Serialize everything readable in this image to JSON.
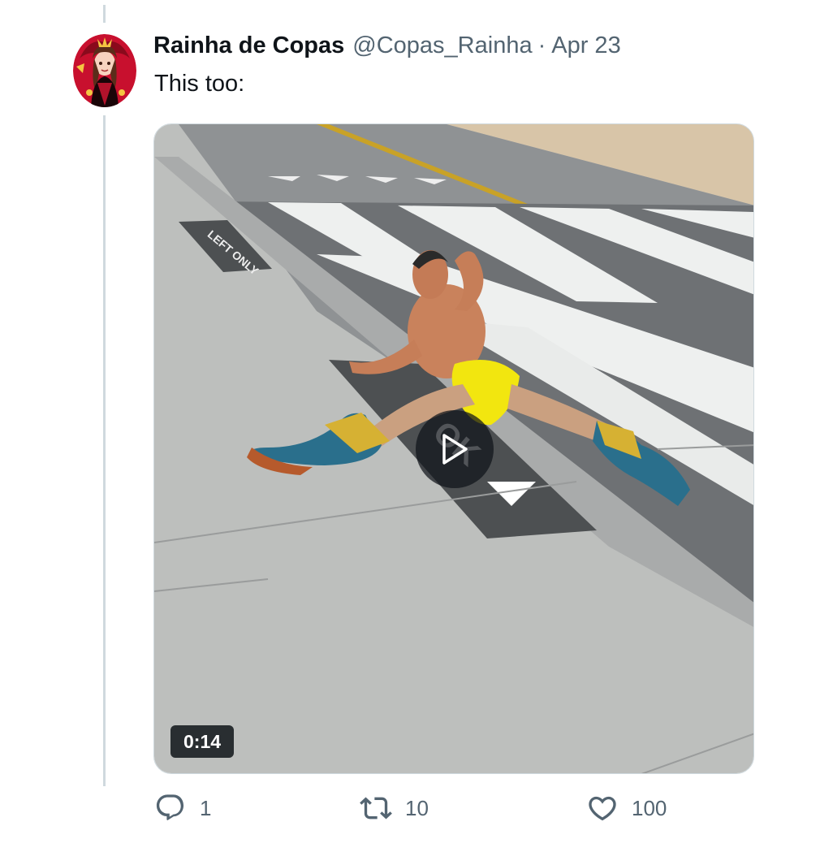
{
  "tweet": {
    "display_name": "Rainha de Copas",
    "handle": "@Copas_Rainha",
    "separator": "·",
    "date": "Apr 23",
    "text": "This too:"
  },
  "media": {
    "type": "video",
    "duration": "0:14",
    "play_icon": "play-icon",
    "road_markings": {
      "left_sign": "LEFT ONLY",
      "center_sign": "OK"
    }
  },
  "actions": {
    "reply": {
      "icon": "reply-icon",
      "count": "1"
    },
    "retweet": {
      "icon": "retweet-icon",
      "count": "10"
    },
    "like": {
      "icon": "heart-icon",
      "count": "100"
    }
  },
  "colors": {
    "text_primary": "#0f1419",
    "text_secondary": "#536471",
    "thread_line": "#cfd9de",
    "overlay": "#0f1419"
  }
}
